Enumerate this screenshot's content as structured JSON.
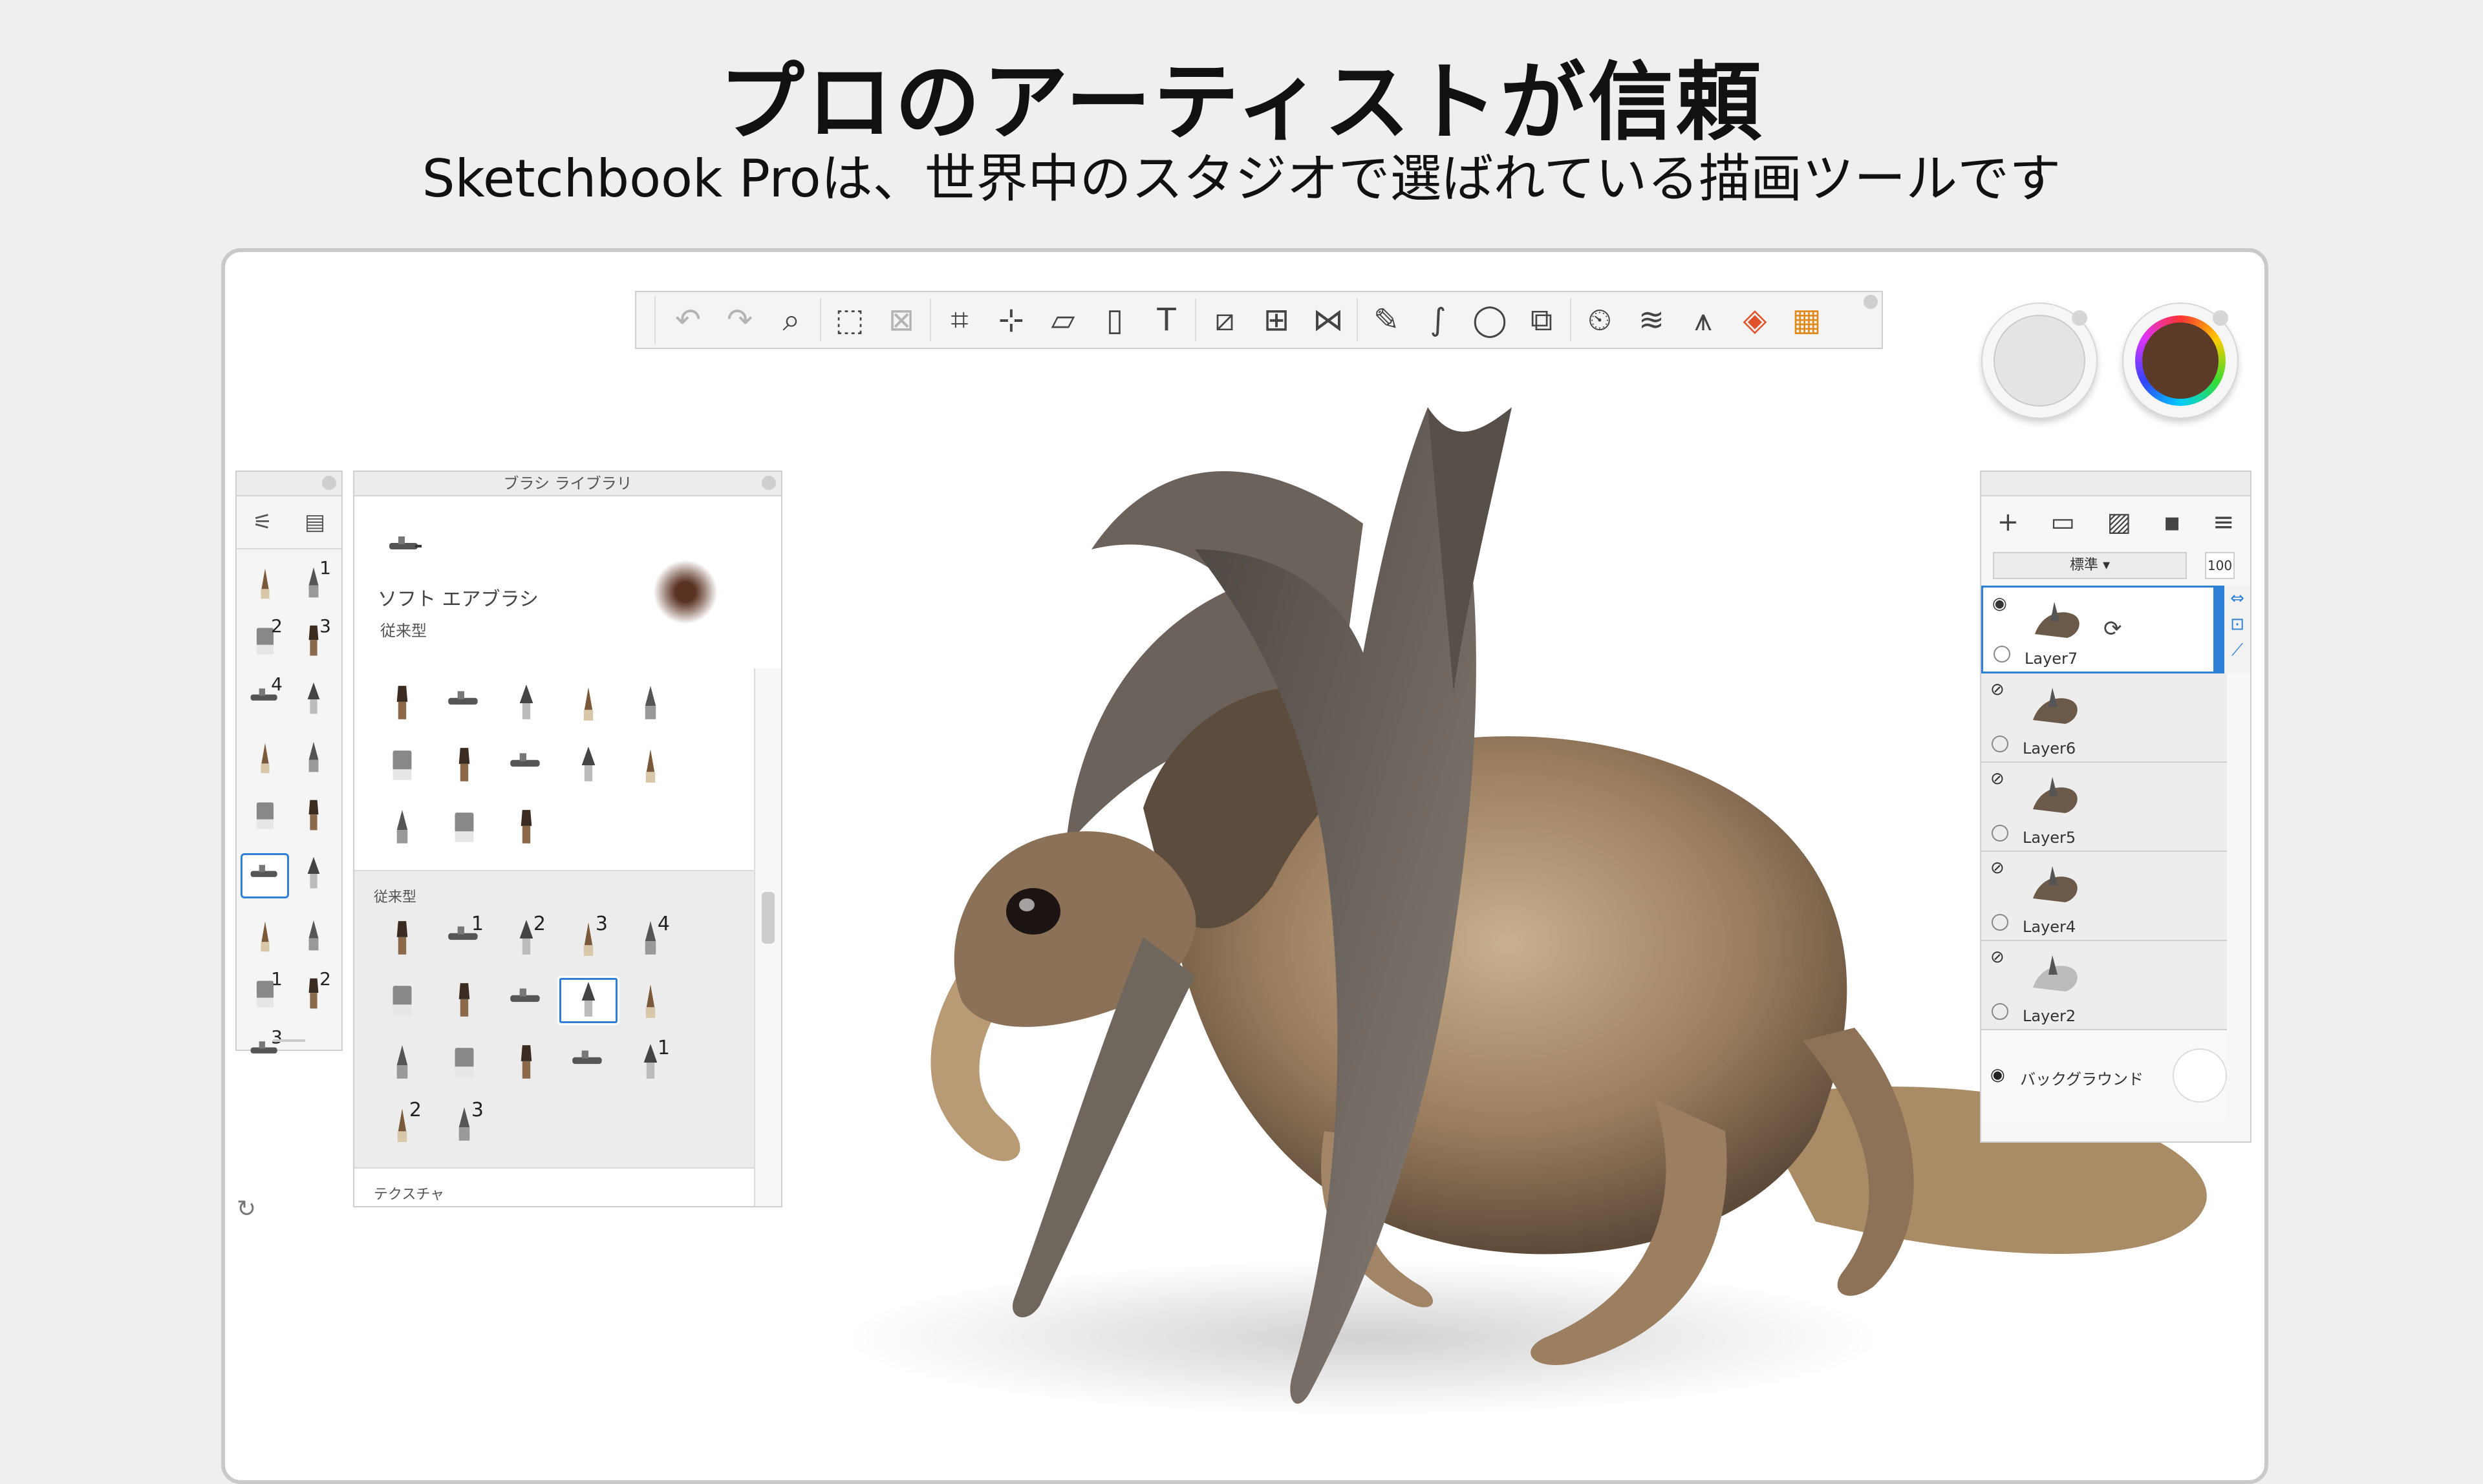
{
  "headline": "プロのアーティストが信頼",
  "subheadline": "Sketchbook Proは、世界中のスタジオで選ばれている描画ツールです",
  "toolbar": {
    "tools": [
      "undo-icon",
      "redo-icon",
      "zoom-icon",
      "|",
      "select-icon",
      "deselect-icon",
      "|",
      "crop-icon",
      "lasso-icon",
      "transform-icon",
      "fill-icon",
      "text-icon",
      "|",
      "ruler-icon",
      "perspective-icon",
      "symmetry-icon",
      "|",
      "pen-icon",
      "curve-icon",
      "ellipse-icon",
      "shape-icon",
      "|",
      "timelapse-icon",
      "layers-icon",
      "brushes-icon",
      "color-editor-icon",
      "swatch-icon"
    ]
  },
  "pucks": {
    "color": "#5c3a28"
  },
  "brush_palette": {
    "brushes": [
      {
        "num": ""
      },
      {
        "num": "1"
      },
      {
        "num": "2"
      },
      {
        "num": "3"
      },
      {
        "num": "4"
      },
      {
        "num": ""
      },
      {
        "num": ""
      },
      {
        "num": ""
      },
      {
        "num": ""
      },
      {
        "num": ""
      },
      {
        "num": ""
      },
      {
        "num": ""
      },
      {
        "num": ""
      },
      {
        "num": ""
      },
      {
        "num": "1"
      },
      {
        "num": "2"
      },
      {
        "num": "3"
      }
    ]
  },
  "library": {
    "title": "ブラシ ライブラリ",
    "selected_name": "ソフト エアブラシ",
    "selected_category": "従来型",
    "section_traditional": "従来型",
    "section_texture": "テクスチャ",
    "top_numbers": [
      "",
      "",
      "",
      "",
      "",
      "",
      "",
      "",
      "",
      "",
      "",
      "",
      ""
    ],
    "traditional_numbers": [
      "",
      "1",
      "2",
      "3",
      "4",
      "",
      "",
      "",
      "",
      "",
      "",
      "",
      "",
      "",
      "1",
      "2",
      "3"
    ]
  },
  "layers": {
    "blend_mode": "標準",
    "opacity": "100",
    "items": [
      {
        "name": "Layer7",
        "active": true
      },
      {
        "name": "Layer6",
        "active": false
      },
      {
        "name": "Layer5",
        "active": false
      },
      {
        "name": "Layer4",
        "active": false
      },
      {
        "name": "Layer2",
        "active": false
      }
    ],
    "background_label": "バックグラウンド"
  }
}
